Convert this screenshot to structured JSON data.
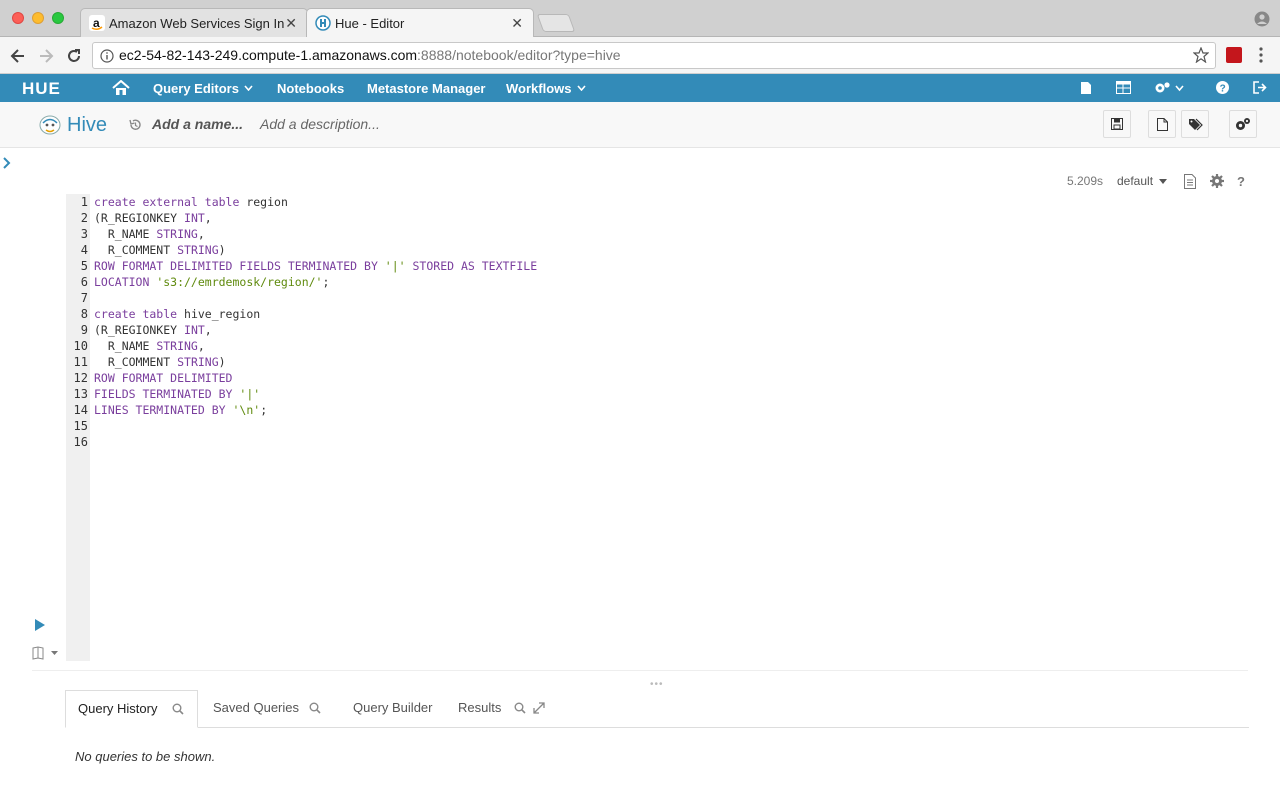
{
  "browser": {
    "tabs": [
      {
        "title": "Amazon Web Services Sign In",
        "active": false
      },
      {
        "title": "Hue - Editor",
        "active": true
      }
    ],
    "url_host": "ec2-54-82-143-249.compute-1.amazonaws.com",
    "url_path": ":8888/notebook/editor?type=hive"
  },
  "huenav": {
    "logo": "HUE",
    "items": [
      "Query Editors",
      "Notebooks",
      "Metastore Manager",
      "Workflows"
    ]
  },
  "editor": {
    "type_title": "Hive",
    "name_placeholder": "Add a name...",
    "description_placeholder": "Add a description...",
    "exec_time": "5.209s",
    "database": "default",
    "line_numbers": [
      "1",
      "2",
      "3",
      "4",
      "5",
      "6",
      "7",
      "8",
      "9",
      "10",
      "11",
      "12",
      "13",
      "14",
      "15",
      "16"
    ],
    "lines": [
      [
        [
          "kw",
          "create external table"
        ],
        [
          "",
          "region"
        ]
      ],
      [
        [
          "",
          "(R_REGIONKEY "
        ],
        [
          "kw",
          "INT"
        ],
        [
          "",
          ","
        ]
      ],
      [
        [
          "",
          "  R_NAME "
        ],
        [
          "kw",
          "STRING"
        ],
        [
          "",
          ","
        ]
      ],
      [
        [
          "",
          "  R_COMMENT "
        ],
        [
          "kw",
          "STRING"
        ],
        [
          "",
          ")"
        ]
      ],
      [
        [
          "kw",
          "ROW FORMAT DELIMITED FIELDS TERMINATED BY "
        ],
        [
          "str",
          "'|'"
        ],
        [
          "kw",
          " STORED AS TEXTFILE"
        ]
      ],
      [
        [
          "kw",
          "LOCATION "
        ],
        [
          "str",
          "'s3://emrdemosk/region/'"
        ],
        [
          "",
          ";"
        ]
      ],
      [],
      [
        [
          "kw",
          "create table"
        ],
        [
          "",
          "hive_region"
        ]
      ],
      [
        [
          "",
          "(R_REGIONKEY "
        ],
        [
          "kw",
          "INT"
        ],
        [
          "",
          ","
        ]
      ],
      [
        [
          "",
          "  R_NAME "
        ],
        [
          "kw",
          "STRING"
        ],
        [
          "",
          ","
        ]
      ],
      [
        [
          "",
          "  R_COMMENT "
        ],
        [
          "kw",
          "STRING"
        ],
        [
          "",
          ")"
        ]
      ],
      [
        [
          "kw",
          "ROW FORMAT DELIMITED"
        ]
      ],
      [
        [
          "kw",
          "FIELDS TERMINATED BY "
        ],
        [
          "str",
          "'|'"
        ]
      ],
      [
        [
          "kw",
          "LINES TERMINATED BY "
        ],
        [
          "str",
          "'\\n'"
        ],
        [
          "",
          ";"
        ]
      ],
      [],
      []
    ]
  },
  "bottom_tabs": [
    "Query History",
    "Saved Queries",
    "Query Builder",
    "Results"
  ],
  "empty_message": "No queries to be shown.",
  "colors": {
    "hue_blue": "#338bb8",
    "keyword": "#7a3e9d",
    "string": "#5f8a0d"
  }
}
